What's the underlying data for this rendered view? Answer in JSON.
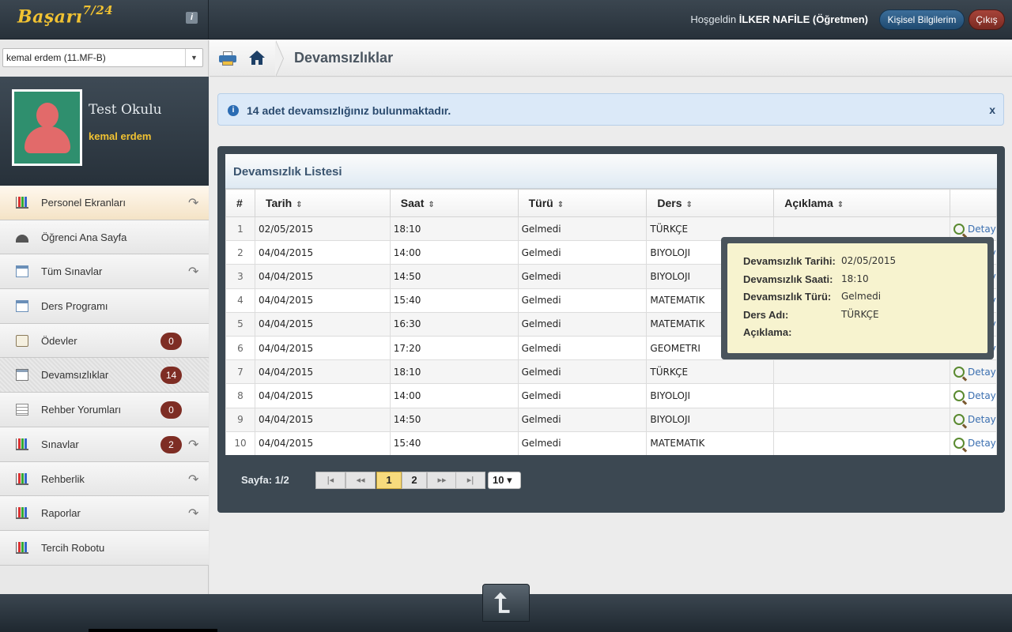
{
  "app": {
    "logo_text": "Başarı",
    "logo_sup": "7/24",
    "info_glyph": "i"
  },
  "header": {
    "welcome_prefix": "Hoşgeldin",
    "user_name": "İLKER NAFİLE (Öğretmen)",
    "profile_button": "Kişisel Bilgilerim",
    "exit_button": "Çıkış"
  },
  "sidebar": {
    "student_select": "kemal erdem (11.MF-B)",
    "school_name": "Test Okulu",
    "student_name": "kemal erdem",
    "items": [
      {
        "label": "Personel Ekranları",
        "badge": "",
        "arrow": true,
        "icon": "chart-icon"
      },
      {
        "label": "Öğrenci Ana Sayfa",
        "badge": "",
        "arrow": false,
        "icon": "gauge-icon"
      },
      {
        "label": "Tüm Sınavlar",
        "badge": "",
        "arrow": true,
        "icon": "table-icon"
      },
      {
        "label": "Ders Programı",
        "badge": "",
        "arrow": false,
        "icon": "table-icon"
      },
      {
        "label": "Ödevler",
        "badge": "0",
        "arrow": false,
        "icon": "clipboard-icon"
      },
      {
        "label": "Devamsızlıklar",
        "badge": "14",
        "arrow": false,
        "icon": "window-warning-icon"
      },
      {
        "label": "Rehber Yorumları",
        "badge": "0",
        "arrow": false,
        "icon": "list-icon"
      },
      {
        "label": "Sınavlar",
        "badge": "2",
        "arrow": true,
        "icon": "chart-icon"
      },
      {
        "label": "Rehberlik",
        "badge": "",
        "arrow": true,
        "icon": "chart-icon"
      },
      {
        "label": "Raporlar",
        "badge": "",
        "arrow": true,
        "icon": "chart-icon"
      },
      {
        "label": "Tercih Robotu",
        "badge": "",
        "arrow": false,
        "icon": "chart-icon"
      }
    ]
  },
  "breadcrumb": {
    "title": "Devamsızlıklar"
  },
  "alert": {
    "text": "14 adet devamsızlığınız bulunmaktadır.",
    "close": "x"
  },
  "panel": {
    "title": "Devamsızlık Listesi",
    "columns": [
      "#",
      "Tarih",
      "Saat",
      "Türü",
      "Ders",
      "Açıklama",
      ""
    ],
    "rows": [
      {
        "n": "1",
        "date": "02/05/2015",
        "time": "18:10",
        "type": "Gelmedi",
        "course": "TÜRKÇE",
        "note": "",
        "action": "Detay"
      },
      {
        "n": "2",
        "date": "04/04/2015",
        "time": "14:00",
        "type": "Gelmedi",
        "course": "BIYOLOJI",
        "note": "",
        "action": "Detay"
      },
      {
        "n": "3",
        "date": "04/04/2015",
        "time": "14:50",
        "type": "Gelmedi",
        "course": "BIYOLOJI",
        "note": "",
        "action": "Detay"
      },
      {
        "n": "4",
        "date": "04/04/2015",
        "time": "15:40",
        "type": "Gelmedi",
        "course": "MATEMATIK",
        "note": "",
        "action": "Detay"
      },
      {
        "n": "5",
        "date": "04/04/2015",
        "time": "16:30",
        "type": "Gelmedi",
        "course": "MATEMATIK",
        "note": "",
        "action": "Detay"
      },
      {
        "n": "6",
        "date": "04/04/2015",
        "time": "17:20",
        "type": "Gelmedi",
        "course": "GEOMETRI",
        "note": "",
        "action": "Detay"
      },
      {
        "n": "7",
        "date": "04/04/2015",
        "time": "18:10",
        "type": "Gelmedi",
        "course": "TÜRKÇE",
        "note": "",
        "action": "Detay"
      },
      {
        "n": "8",
        "date": "04/04/2015",
        "time": "14:00",
        "type": "Gelmedi",
        "course": "BIYOLOJI",
        "note": "",
        "action": "Detay"
      },
      {
        "n": "9",
        "date": "04/04/2015",
        "time": "14:50",
        "type": "Gelmedi",
        "course": "BIYOLOJI",
        "note": "",
        "action": "Detay"
      },
      {
        "n": "10",
        "date": "04/04/2015",
        "time": "15:40",
        "type": "Gelmedi",
        "course": "MATEMATIK",
        "note": "",
        "action": "Detay"
      }
    ]
  },
  "pager": {
    "label": "Sayfa: 1/2",
    "first": "|◂",
    "prev": "◂◂",
    "pages": [
      "1",
      "2"
    ],
    "current": "1",
    "next": "▸▸",
    "last": "▸|",
    "per_page": "10 ▾"
  },
  "tooltip": {
    "rows": [
      {
        "label": "Devamsızlık Tarihi:",
        "value": "02/05/2015"
      },
      {
        "label": "Devamsızlık Saati:",
        "value": "18:10"
      },
      {
        "label": "Devamsızlık Türü:",
        "value": "Gelmedi"
      },
      {
        "label": "Ders Adı:",
        "value": "TÜRKÇE"
      },
      {
        "label": "Açıklama:",
        "value": ""
      }
    ]
  },
  "footer": {
    "to_top_glyph": "⮤"
  },
  "colors": {
    "accent_gold": "#f1c232",
    "badge_red": "#7e2d24",
    "dark_header": "#3c4852",
    "alert_blue": "#dbe9f8",
    "tooltip_bg": "#f7f3cf"
  }
}
